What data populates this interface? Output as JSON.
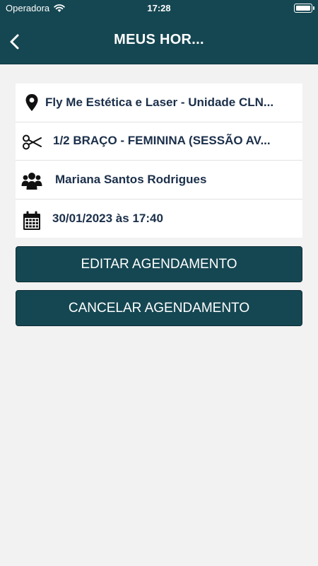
{
  "status_bar": {
    "carrier": "Operadora",
    "time": "17:28"
  },
  "header": {
    "title": "MEUS HOR..."
  },
  "appointment": {
    "location": "Fly Me Estética e Laser - Unidade CLN...",
    "service": "1/2 BRAÇO - FEMININA (SESSÃO AV...",
    "client": "Mariana Santos Rodrigues",
    "datetime": "30/01/2023 às 17:40"
  },
  "icons": {
    "location": "map-pin-icon",
    "service": "scissors-icon",
    "client": "users-icon",
    "datetime": "calendar-icon"
  },
  "actions": {
    "edit_label": "EDITAR AGENDAMENTO",
    "cancel_label": "CANCELAR AGENDAMENTO"
  },
  "colors": {
    "primary": "#154752",
    "background": "#f2f2f2",
    "text": "#1b2f4a"
  }
}
